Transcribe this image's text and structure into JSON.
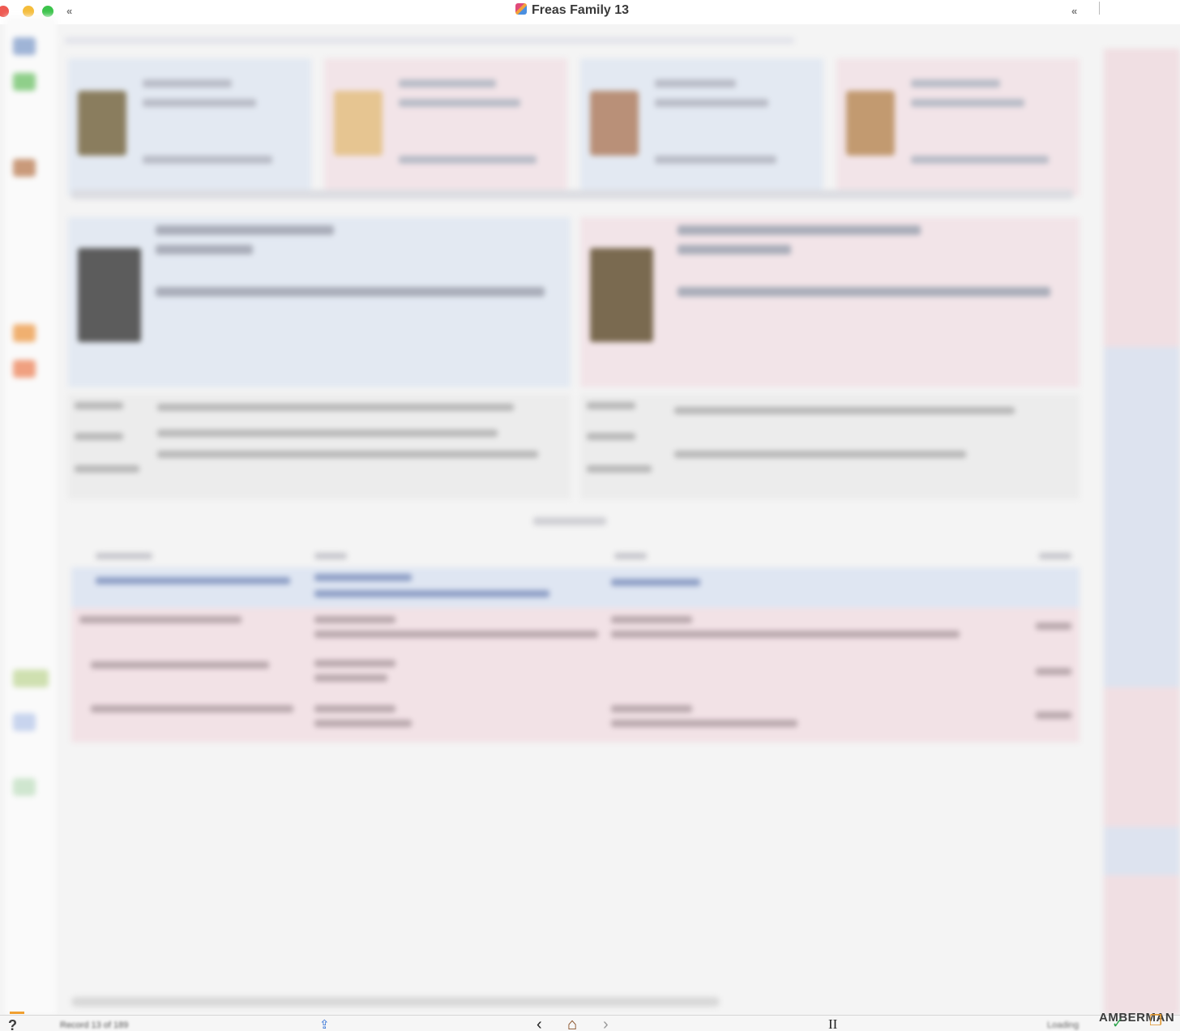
{
  "window": {
    "title": "Freas Family 13",
    "left_collapse_glyph": "«",
    "right_collapse_glyph": "«"
  },
  "statusbar": {
    "help_glyph": "?",
    "record_count": "Record 13 of 189",
    "share_glyph": "⇪",
    "back_glyph": "‹",
    "home_glyph": "⌂",
    "forward_glyph": "›",
    "pause_glyph": "II",
    "right_status": "Loading",
    "check_glyph": "✓",
    "window_glyph": "❐",
    "person_name": "AMBERMAN"
  },
  "colors": {
    "male_card": "#e3e9f2",
    "female_card": "#f2e4e8",
    "selected_row": "#dfe6f2",
    "accent": "#2f6fd6"
  },
  "icons": {
    "help": "help-icon",
    "share": "share-icon",
    "back": "back-arrow-icon",
    "home": "home-icon",
    "forward": "forward-arrow-icon",
    "pause": "pause-icon",
    "check": "checkmark-icon",
    "window": "window-icon"
  }
}
